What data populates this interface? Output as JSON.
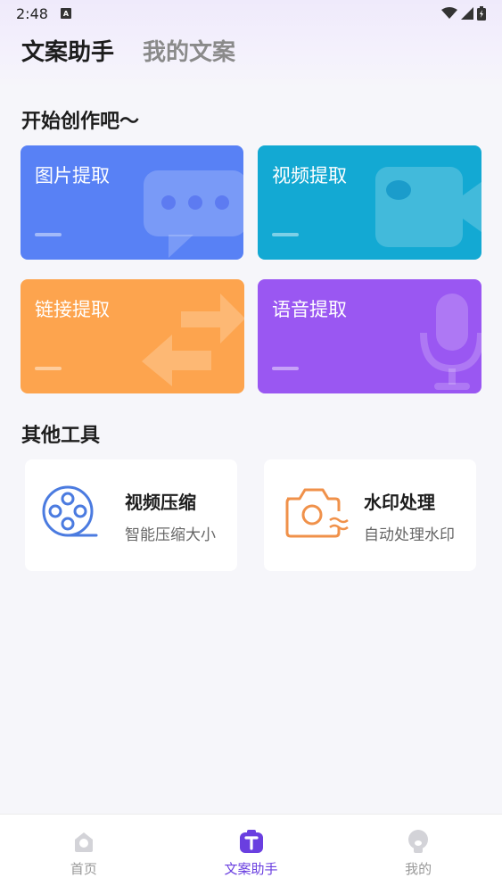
{
  "status_bar": {
    "time": "2:48",
    "notification_badge": "A"
  },
  "header": {
    "tabs": [
      {
        "label": "文案助手",
        "active": true
      },
      {
        "label": "我的文案",
        "active": false
      }
    ]
  },
  "create_section": {
    "title": "开始创作吧～",
    "cards": [
      {
        "label": "图片提取",
        "color": "#5881f5",
        "icon": "chat-bubble-icon"
      },
      {
        "label": "视频提取",
        "color": "#13a9d3",
        "icon": "video-camera-icon"
      },
      {
        "label": "链接提取",
        "color": "#fda44e",
        "icon": "swap-arrows-icon"
      },
      {
        "label": "语音提取",
        "color": "#9a57f2",
        "icon": "microphone-icon"
      }
    ]
  },
  "tools_section": {
    "title": "其他工具",
    "tools": [
      {
        "name": "视频压缩",
        "desc": "智能压缩大小",
        "icon": "film-reel-icon",
        "color": "#4b7be0"
      },
      {
        "name": "水印处理",
        "desc": "自动处理水印",
        "icon": "camera-watermark-icon",
        "color": "#f0914a"
      }
    ]
  },
  "bottom_nav": {
    "items": [
      {
        "label": "首页",
        "active": false,
        "icon": "home-icon"
      },
      {
        "label": "文案助手",
        "active": true,
        "icon": "text-assistant-icon"
      },
      {
        "label": "我的",
        "active": false,
        "icon": "profile-icon"
      }
    ],
    "active_color": "#6a3fe0"
  }
}
